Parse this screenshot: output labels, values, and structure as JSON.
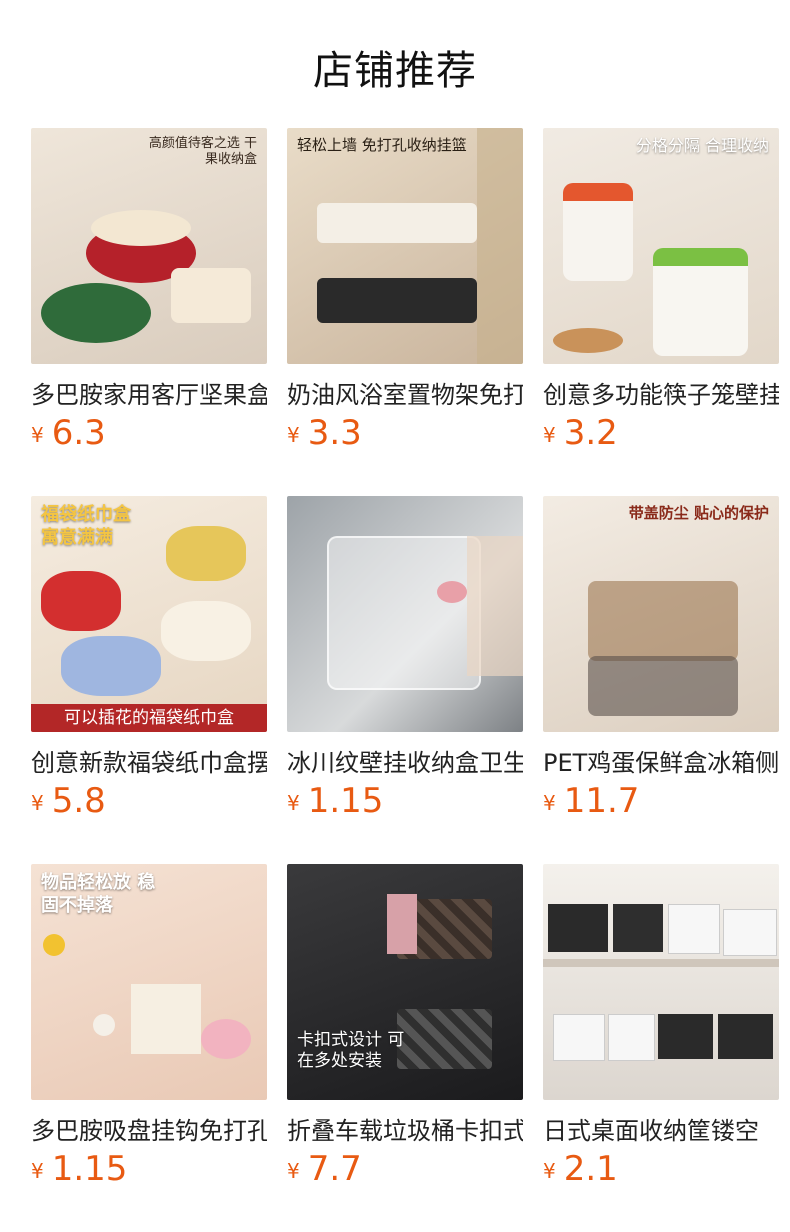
{
  "page": {
    "title": "店铺推荐"
  },
  "colors": {
    "price": "#e85a12",
    "title": "#111111",
    "text": "#222222"
  },
  "products": [
    {
      "name": "多巴胺家用客厅坚果盒",
      "currency": "¥",
      "price": "6.3",
      "image_text": "高颜值待客之选 干果收纳盒",
      "image_bg": "#e8ddd0"
    },
    {
      "name": "奶油风浴室置物架免打孔",
      "currency": "¥",
      "price": "3.3",
      "image_text": "轻松上墙 免打孔收纳挂篮",
      "image_bg": "#dcc9b2"
    },
    {
      "name": "创意多功能筷子笼壁挂",
      "currency": "¥",
      "price": "3.2",
      "image_text": "分格分隔 合理收纳",
      "image_bg": "#eee6dc"
    },
    {
      "name": "创意新款福袋纸巾盒摆件",
      "currency": "¥",
      "price": "5.8",
      "image_text": "福袋纸巾盒 寓意满满",
      "image_banner": "可以插花的福袋纸巾盒",
      "image_bg": "#f1e6d6"
    },
    {
      "name": "冰川纹壁挂收纳盒卫生间",
      "currency": "¥",
      "price": "1.15",
      "image_text": "",
      "image_bg": "#bfc3c6"
    },
    {
      "name": "PET鸡蛋保鲜盒冰箱侧门",
      "currency": "¥",
      "price": "11.7",
      "image_text": "带盖防尘 贴心的保护",
      "image_bg": "#ece3d8"
    },
    {
      "name": "多巴胺吸盘挂钩免打孔",
      "currency": "¥",
      "price": "1.15",
      "image_text": "物品轻松放 稳固不掉落",
      "image_bg": "#f0d8c8"
    },
    {
      "name": "折叠车载垃圾桶卡扣式",
      "currency": "¥",
      "price": "7.7",
      "image_text": "卡扣式设计 可在多处安装",
      "image_bg": "#2c2c2e"
    },
    {
      "name": "日式桌面收纳筐镂空",
      "currency": "¥",
      "price": "2.1",
      "image_text": "",
      "image_bg": "#e7e2dc"
    }
  ]
}
